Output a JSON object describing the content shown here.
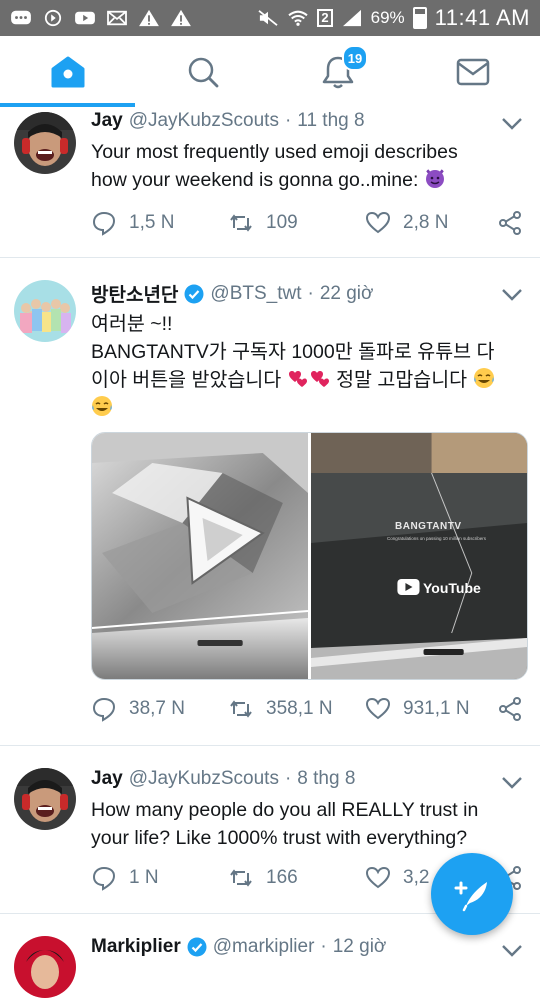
{
  "status_bar": {
    "battery": "69%",
    "time": "11:41 AM",
    "sim_slot": "2"
  },
  "nav": {
    "tabs": [
      {
        "name": "home",
        "icon": "home-icon",
        "active": true
      },
      {
        "name": "search",
        "icon": "search-icon"
      },
      {
        "name": "notifications",
        "icon": "bell-icon",
        "badge": "19"
      },
      {
        "name": "messages",
        "icon": "mail-icon"
      }
    ]
  },
  "colors": {
    "accent": "#1da1f2",
    "secondary_text": "#657786",
    "primary_text": "#14171a",
    "divider": "#e1e8ed",
    "heart_emoji": "#e0245e"
  },
  "tweets": [
    {
      "name": "Jay",
      "handle": "@JayKubzScouts",
      "dot": "·",
      "time": "11 thg 8",
      "verified": false,
      "text_line1": "Your most frequently used emoji describes",
      "text_line2": "how your weekend is gonna go..mine:",
      "replies": "1,5 N",
      "retweets": "109",
      "likes": "2,8 N"
    },
    {
      "name": "방탄소년단",
      "handle": "@BTS_twt",
      "dot": "·",
      "time": "22 giờ",
      "verified": true,
      "text_line1": "여러분 ~!!",
      "text_line2": "BANGTANTV가 구독자 1000만 돌파로 유튜브 다",
      "text_line3a": "이아 버튼을 받았습니다",
      "text_line3b": "정말 고맙습니다",
      "media_caption_title": "BANGTANTV",
      "media_caption_sub": "Congratulations on passing 10 million subscribers",
      "media_logo": "YouTube",
      "replies": "38,7 N",
      "retweets": "358,1 N",
      "likes": "931,1 N"
    },
    {
      "name": "Jay",
      "handle": "@JayKubzScouts",
      "dot": "·",
      "time": "8 thg 8",
      "verified": false,
      "text_line1": "How many people do you all REALLY trust in",
      "text_line2": "your life? Like 1000% trust with everything?",
      "replies": "1 N",
      "retweets": "166",
      "likes": "3,2"
    },
    {
      "name": "Markiplier",
      "handle": "@markiplier",
      "dot": "·",
      "time": "12 giờ",
      "verified": true
    }
  ],
  "fab": {
    "icon": "compose-tweet-icon"
  }
}
